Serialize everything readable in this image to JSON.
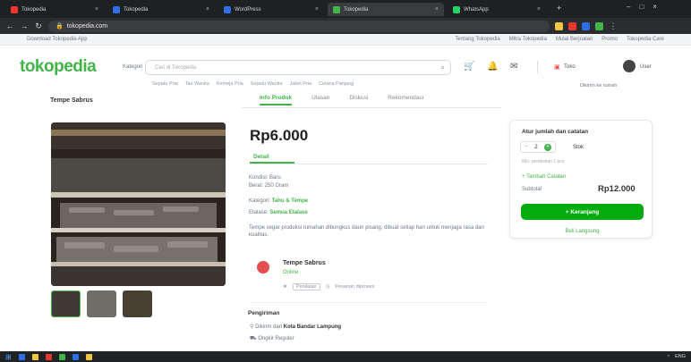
{
  "browser": {
    "tabs": [
      {
        "label": "Tokopedia",
        "color": "#e9372f"
      },
      {
        "label": "Tokopedia",
        "color": "#2f6ee9"
      },
      {
        "label": "WordPress",
        "color": "#2f6ee9"
      },
      {
        "label": "Tokopedia",
        "color": "#42b549",
        "active": true
      },
      {
        "label": "WhatsApp",
        "color": "#25d366"
      }
    ],
    "url": "tokopedia.com",
    "ext_colors": [
      "#f4c542",
      "#e9372f",
      "#2f6ee9",
      "#42b549"
    ]
  },
  "topstrip": {
    "left": "Download Tokopedia App",
    "links": [
      "Tentang Tokopedia",
      "Mitra Tokopedia",
      "Mulai Berjualan",
      "Promo",
      "Tokopedia Care"
    ]
  },
  "header": {
    "logo": "tokopedia",
    "kategori": "Kategori",
    "search_placeholder": "Cari di Tokopedia",
    "shop_label": "Toko",
    "user_label": "User",
    "quick_links": [
      "Sepatu Pria",
      "Tas Wanita",
      "Kemeja Pria",
      "Sepatu Wanita",
      "Jaket Pria",
      "Celana Panjang"
    ],
    "location": "Dikirim ke rumah"
  },
  "shop": {
    "name": "Tempe Sabrus"
  },
  "tabs": [
    "Info Produk",
    "Ulasan",
    "Diskusi",
    "Rekomendasi"
  ],
  "product": {
    "price": "Rp6.000",
    "detail_tab": "Detail",
    "specs": [
      {
        "label": "Kondisi:",
        "value": "Baru"
      },
      {
        "label": "Berat:",
        "value": "250 Gram"
      },
      {
        "label": "Kategori:",
        "value": "Tahu & Tempe",
        "link": true
      },
      {
        "label": "Etalase:",
        "value": "Semua Etalase",
        "link": true
      }
    ],
    "description": "Tempe segar produksi rumahan dibungkus daun pisang, dibuat setiap hari untuk menjaga rasa dan kualitas.",
    "thumb_colors": [
      "#3e3a33",
      "#6f6d67",
      "#4a3f33"
    ]
  },
  "seller": {
    "name": "Tempe Sabrus",
    "status": "Online",
    "rating": "Penilaian",
    "processing": "Pesanan diproses"
  },
  "shipping": {
    "title": "Pengiriman",
    "from_label": "Dikirim dari",
    "from_value": "Kota Bandar Lampung",
    "service": "Ongkir Reguler"
  },
  "buy": {
    "title": "Atur jumlah dan catatan",
    "qty": "2",
    "minus": "−",
    "plus": "+",
    "stock": "Stok",
    "min_note": "Min. pembelian 1 pcs",
    "note_link": "+ Tambah Catatan",
    "subtotal_label": "Subtotal",
    "subtotal": "Rp12.000",
    "cart_button": "+ Keranjang",
    "buy_button": "Beli Langsung"
  },
  "taskbar": {
    "tray_text": "ENG",
    "icon_colors": [
      "#2f6ee9",
      "#f4c542",
      "#e9372f",
      "#42b549",
      "#2f6ee9",
      "#f4c542"
    ]
  }
}
